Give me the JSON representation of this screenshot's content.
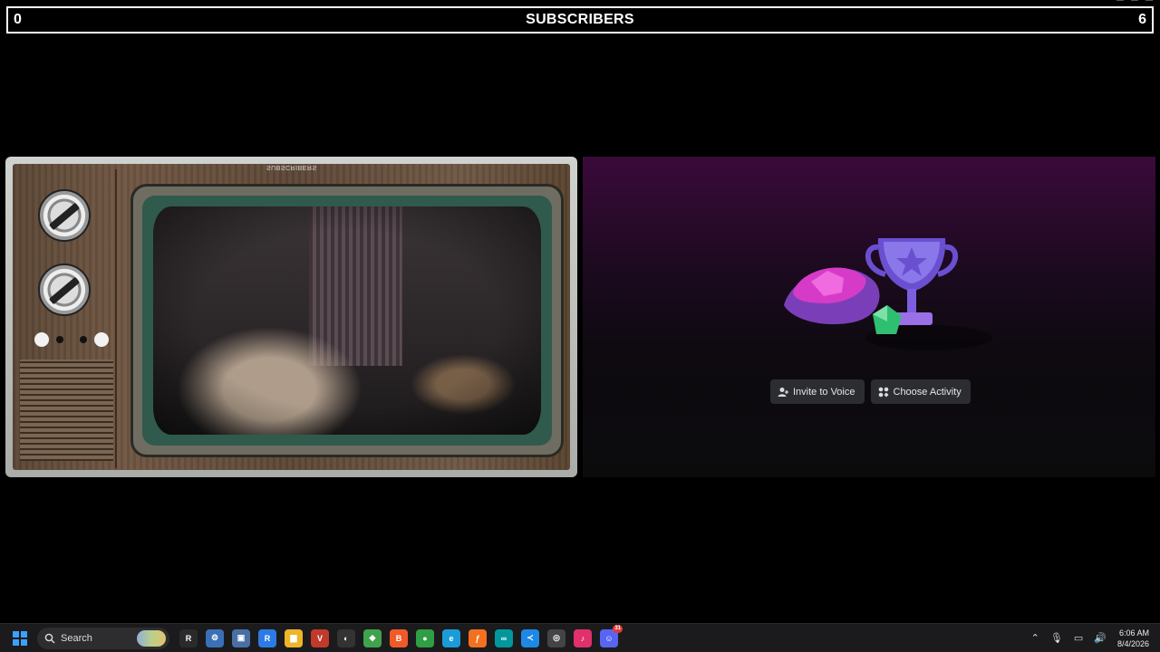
{
  "subscriber_bar": {
    "left_count": "0",
    "title": "SUBSCRIBERS",
    "right_count": "6"
  },
  "tv": {
    "mirrored_label": "SUBSCRIBERS"
  },
  "stage": {
    "invite_label": "Invite to Voice",
    "activity_label": "Choose Activity"
  },
  "taskbar": {
    "search_placeholder": "Search",
    "apps": [
      {
        "icon": "resolve-icon",
        "color": "#2a2a2a",
        "glyph": "R"
      },
      {
        "icon": "network-icon",
        "color": "#3b6fb6",
        "glyph": "⚙"
      },
      {
        "icon": "remote-icon",
        "color": "#4a6fa5",
        "glyph": "▣"
      },
      {
        "icon": "rapid-icon",
        "color": "#2c7be5",
        "glyph": "R"
      },
      {
        "icon": "folder-icon",
        "color": "#f0b429",
        "glyph": "▆"
      },
      {
        "icon": "voicemod-icon",
        "color": "#c0392b",
        "glyph": "V"
      },
      {
        "icon": "obs-icon",
        "color": "#333333",
        "glyph": "◐"
      },
      {
        "icon": "vpn-icon",
        "color": "#3fa34d",
        "glyph": "◆"
      },
      {
        "icon": "brave-icon",
        "color": "#f05a28",
        "glyph": "B"
      },
      {
        "icon": "chrome-icon",
        "color": "#2f9e44",
        "glyph": "●"
      },
      {
        "icon": "edge-icon",
        "color": "#1b9cd8",
        "glyph": "e"
      },
      {
        "icon": "firefox-icon",
        "color": "#f37021",
        "glyph": "ƒ"
      },
      {
        "icon": "arduino-icon",
        "color": "#00979d",
        "glyph": "∞"
      },
      {
        "icon": "vscode-icon",
        "color": "#1e88e5",
        "glyph": "≺"
      },
      {
        "icon": "steam-icon",
        "color": "#444",
        "glyph": "◎"
      },
      {
        "icon": "tiktok-icon",
        "color": "#e1306c",
        "glyph": "♪"
      },
      {
        "icon": "discord-icon",
        "color": "#5865f2",
        "glyph": "☺"
      }
    ],
    "time": "6:06 AM",
    "date": "8/4/2026",
    "discord_badge": "31"
  },
  "colors": {
    "accent_purple": "#a23bd6",
    "stage_top": "#3a0a3a",
    "button_bg": "#2b2d31"
  }
}
